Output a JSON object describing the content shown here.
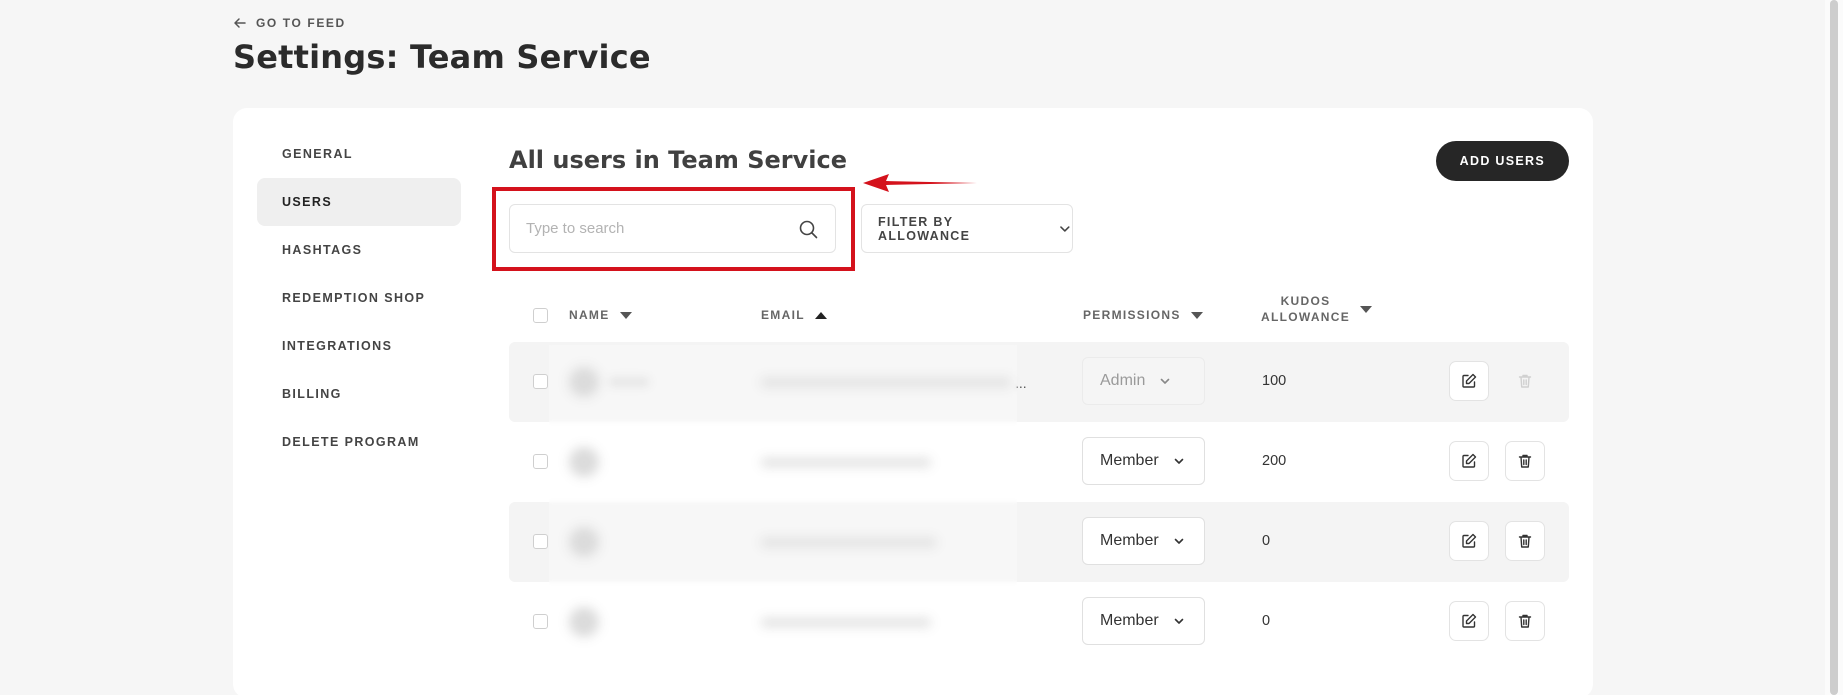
{
  "header": {
    "back_label": "GO TO FEED",
    "title": "Settings: Team Service"
  },
  "sidebar": {
    "items": [
      {
        "label": "GENERAL",
        "active": false
      },
      {
        "label": "USERS",
        "active": true
      },
      {
        "label": "HASHTAGS",
        "active": false
      },
      {
        "label": "REDEMPTION SHOP",
        "active": false
      },
      {
        "label": "INTEGRATIONS",
        "active": false
      },
      {
        "label": "BILLING",
        "active": false
      },
      {
        "label": "DELETE PROGRAM",
        "active": false
      }
    ]
  },
  "main": {
    "section_title": "All users in Team Service",
    "add_users_label": "ADD USERS",
    "search_placeholder": "Type to search",
    "filter_label": "FILTER BY ALLOWANCE",
    "columns": {
      "name": "NAME",
      "email": "EMAIL",
      "permissions": "PERMISSIONS",
      "kudos_line1": "KUDOS",
      "kudos_line2": "ALLOWANCE"
    },
    "rows": [
      {
        "permission": "Admin",
        "allowance": "100",
        "permission_disabled": true,
        "delete_disabled": true,
        "email_truncated": "..."
      },
      {
        "permission": "Member",
        "allowance": "200",
        "permission_disabled": false,
        "delete_disabled": false
      },
      {
        "permission": "Member",
        "allowance": "0",
        "permission_disabled": false,
        "delete_disabled": false
      },
      {
        "permission": "Member",
        "allowance": "0",
        "permission_disabled": false,
        "delete_disabled": false
      }
    ]
  },
  "colors": {
    "highlight": "#d4121c",
    "primary_button": "#262626"
  }
}
